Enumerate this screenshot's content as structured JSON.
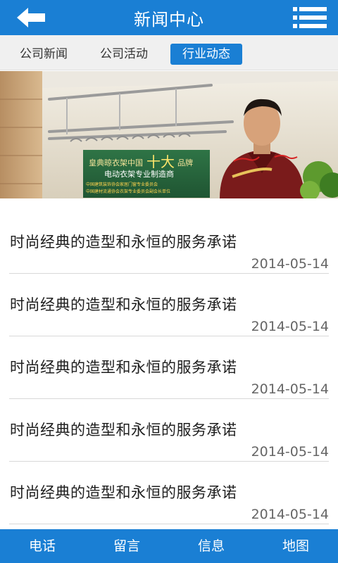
{
  "header": {
    "title": "新闻中心",
    "back_icon": "arrow-left-icon",
    "menu_icon": "menu-list-icon",
    "color": "#1a7fd4"
  },
  "tabs": [
    {
      "label": "公司新闻",
      "active": false
    },
    {
      "label": "公司活动",
      "active": false
    },
    {
      "label": "行业动态",
      "active": true
    }
  ],
  "banner": {
    "headline_prefix": "皇典晾衣架中国",
    "headline_big": "十大",
    "headline_suffix": "品牌",
    "subline": "电动衣架专业制造商",
    "line3": "中国建筑装饰协会家居门窗专业委员会",
    "line4": "中国建材流通协会衣架专业委员会副会长单位"
  },
  "news": [
    {
      "title": "时尚经典的造型和永恒的服务承诺",
      "date": "2014-05-14"
    },
    {
      "title": "时尚经典的造型和永恒的服务承诺",
      "date": "2014-05-14"
    },
    {
      "title": "时尚经典的造型和永恒的服务承诺",
      "date": "2014-05-14"
    },
    {
      "title": "时尚经典的造型和永恒的服务承诺",
      "date": "2014-05-14"
    },
    {
      "title": "时尚经典的造型和永恒的服务承诺",
      "date": "2014-05-14"
    }
  ],
  "bottom_nav": [
    {
      "label": "电话"
    },
    {
      "label": "留言"
    },
    {
      "label": "信息"
    },
    {
      "label": "地图"
    }
  ]
}
